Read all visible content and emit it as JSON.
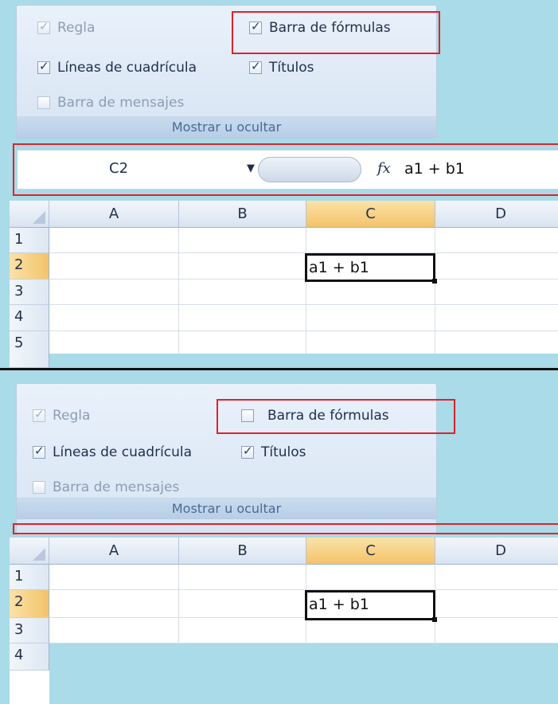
{
  "top": {
    "ribbon": {
      "checkboxes": [
        {
          "label": "Regla",
          "checked": true,
          "disabled": true
        },
        {
          "label": "Barra de fórmulas",
          "checked": true,
          "disabled": false
        },
        {
          "label": "Líneas de cuadrícula",
          "checked": true,
          "disabled": false
        },
        {
          "label": "Títulos",
          "checked": true,
          "disabled": false
        },
        {
          "label": "Barra de mensajes",
          "checked": false,
          "disabled": true
        }
      ],
      "group_label": "Mostrar u ocultar"
    },
    "formula_bar": {
      "name_box": "C2",
      "fx_label": "fx",
      "formula": "a1 + b1"
    },
    "grid": {
      "columns": [
        "A",
        "B",
        "C",
        "D"
      ],
      "rows": [
        "1",
        "2",
        "3",
        "4",
        "5"
      ],
      "active_cell_value": "a1 + b1"
    }
  },
  "bottom": {
    "ribbon": {
      "checkboxes": [
        {
          "label": "Regla",
          "checked": true,
          "disabled": true
        },
        {
          "label": "Barra de fórmulas",
          "checked": false,
          "disabled": false
        },
        {
          "label": "Líneas de cuadrícula",
          "checked": true,
          "disabled": false
        },
        {
          "label": "Títulos",
          "checked": true,
          "disabled": false
        },
        {
          "label": "Barra de mensajes",
          "checked": false,
          "disabled": true
        }
      ],
      "group_label": "Mostrar u ocultar"
    },
    "grid": {
      "columns": [
        "A",
        "B",
        "C",
        "D"
      ],
      "rows": [
        "1",
        "2",
        "3",
        "4"
      ],
      "active_cell_value": "a1 + b1"
    }
  },
  "colors": {
    "highlight": "#e0222a",
    "background": "#a9dbe8",
    "selected_header": "#f4c36a"
  }
}
